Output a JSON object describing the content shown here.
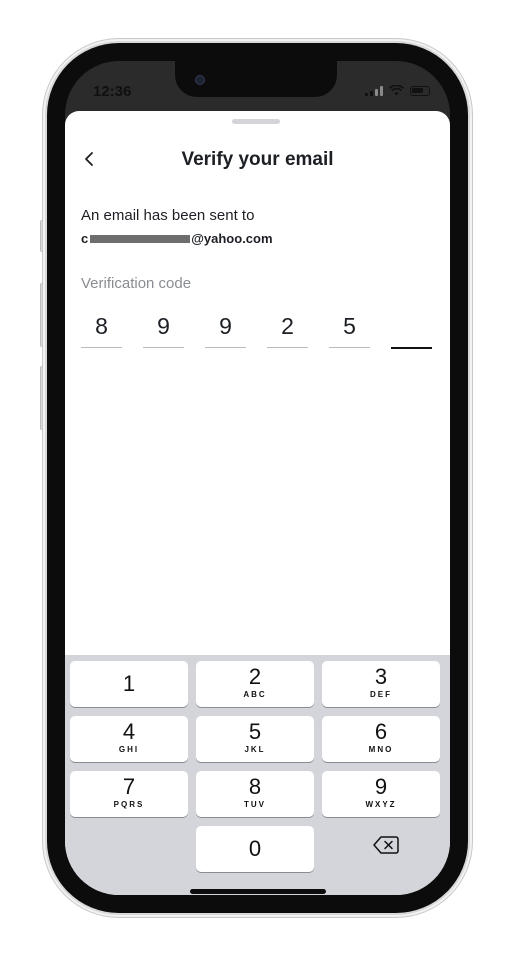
{
  "status_bar": {
    "time": "12:36"
  },
  "header": {
    "title": "Verify your email",
    "back_icon": "chevron-left-icon"
  },
  "content": {
    "description": "An email has been sent to",
    "email_prefix": "c",
    "email_suffix": "@yahoo.com",
    "code_label": "Verification code",
    "code_digits": [
      "8",
      "9",
      "9",
      "2",
      "5",
      ""
    ]
  },
  "keypad": {
    "keys": [
      {
        "num": "1",
        "letters": ""
      },
      {
        "num": "2",
        "letters": "ABC"
      },
      {
        "num": "3",
        "letters": "DEF"
      },
      {
        "num": "4",
        "letters": "GHI"
      },
      {
        "num": "5",
        "letters": "JKL"
      },
      {
        "num": "6",
        "letters": "MNO"
      },
      {
        "num": "7",
        "letters": "PQRS"
      },
      {
        "num": "8",
        "letters": "TUV"
      },
      {
        "num": "9",
        "letters": "WXYZ"
      },
      {
        "num": "0",
        "letters": ""
      }
    ],
    "delete_icon": "backspace-icon"
  }
}
